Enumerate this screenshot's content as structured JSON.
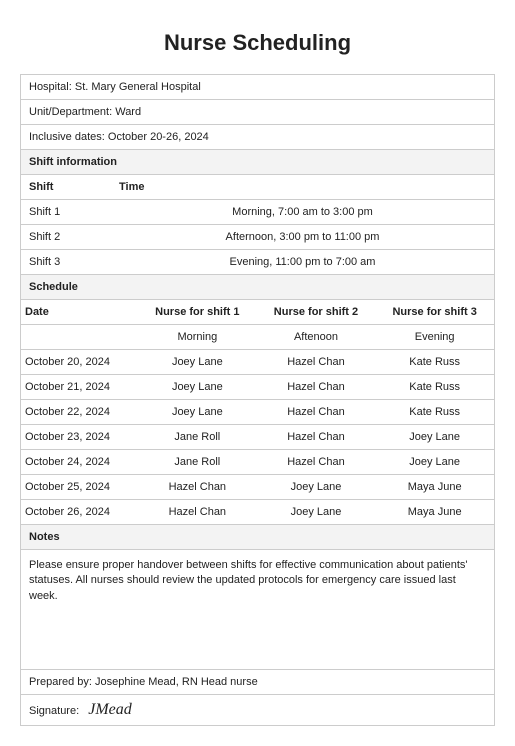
{
  "title": "Nurse Scheduling",
  "info": {
    "hospital_label": "Hospital:",
    "hospital_value": "St. Mary General Hospital",
    "unit_label": "Unit/Department:",
    "unit_value": "Ward",
    "dates_label": "Inclusive dates:",
    "dates_value": "October 20-26, 2024"
  },
  "shift_section": {
    "header": "Shift information",
    "col_shift": "Shift",
    "col_time": "Time",
    "rows": [
      {
        "shift": "Shift 1",
        "time": "Morning, 7:00 am to 3:00 pm"
      },
      {
        "shift": "Shift 2",
        "time": "Afternoon, 3:00 pm to 11:00 pm"
      },
      {
        "shift": "Shift 3",
        "time": "Evening, 11:00 pm to 7:00 am"
      }
    ]
  },
  "schedule_section": {
    "header": "Schedule",
    "col_date": "Date",
    "col_n1": "Nurse for shift 1",
    "col_n2": "Nurse for shift 2",
    "col_n3": "Nurse for shift 3",
    "sub1": "Morning",
    "sub2": "Aftenoon",
    "sub3": "Evening",
    "rows": [
      {
        "date": "October 20, 2024",
        "n1": "Joey Lane",
        "n2": "Hazel Chan",
        "n3": "Kate Russ"
      },
      {
        "date": "October 21, 2024",
        "n1": "Joey Lane",
        "n2": "Hazel Chan",
        "n3": "Kate Russ"
      },
      {
        "date": "October 22, 2024",
        "n1": "Joey Lane",
        "n2": "Hazel Chan",
        "n3": "Kate Russ"
      },
      {
        "date": "October 23, 2024",
        "n1": "Jane Roll",
        "n2": "Hazel Chan",
        "n3": "Joey Lane"
      },
      {
        "date": "October 24, 2024",
        "n1": "Jane Roll",
        "n2": "Hazel Chan",
        "n3": "Joey Lane"
      },
      {
        "date": "October 25, 2024",
        "n1": "Hazel Chan",
        "n2": "Joey Lane",
        "n3": "Maya June"
      },
      {
        "date": "October 26, 2024",
        "n1": "Hazel Chan",
        "n2": "Joey Lane",
        "n3": "Maya June"
      }
    ]
  },
  "notes_section": {
    "header": "Notes",
    "text": "Please ensure proper handover between shifts for effective communication about patients' statuses. All nurses should review the updated protocols for emergency care issued last week."
  },
  "footer": {
    "prepared_label": "Prepared by:",
    "prepared_value": "Josephine Mead, RN  Head nurse",
    "signature_label": "Signature:",
    "signature_value": "JMead"
  }
}
